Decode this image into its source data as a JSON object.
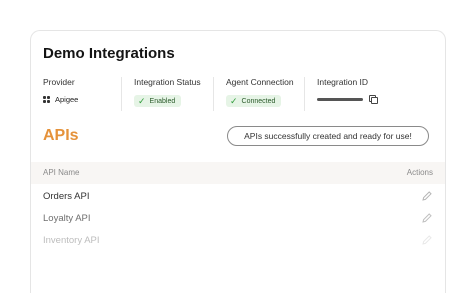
{
  "card": {
    "title": "Demo Integrations"
  },
  "meta": {
    "provider": {
      "label": "Provider",
      "value": "Apigee",
      "icon": "apigee-icon"
    },
    "integration_status": {
      "label": "Integration Status",
      "value": "Enabled"
    },
    "agent_connection": {
      "label": "Agent Connection",
      "value": "Connected"
    },
    "integration_id": {
      "label": "Integration ID"
    }
  },
  "apis": {
    "title": "APIs",
    "toast": "APIs successfully created and ready for use!",
    "columns": {
      "name": "API Name",
      "actions": "Actions"
    },
    "rows": [
      {
        "name": "Orders API"
      },
      {
        "name": "Loyalty API"
      },
      {
        "name": "Inventory API"
      }
    ]
  },
  "colors": {
    "accent": "#e5923a",
    "status_bg": "#e6f4e6",
    "status_check": "#2e9b3a",
    "table_header_bg": "#f8f6f4"
  }
}
